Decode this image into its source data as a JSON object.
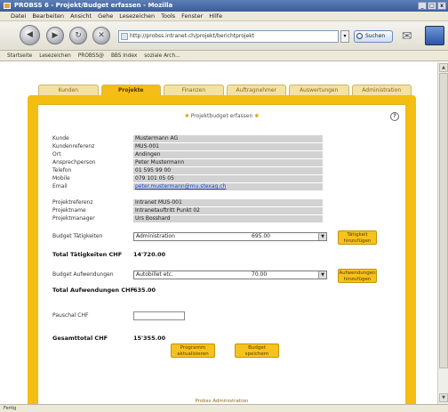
{
  "window": {
    "title": "PROBSS 6 - Projekt/Budget erfassen - Mozilla",
    "controls": [
      "_",
      "□",
      "x"
    ]
  },
  "menu": [
    "Datei",
    "Bearbeiten",
    "Ansicht",
    "Gehe",
    "Lesezeichen",
    "Tools",
    "Fenster",
    "Hilfe"
  ],
  "nav": {
    "url": "http://probss.intranet.ch/projekt/berichtprojekt",
    "search_label": "Suchen",
    "go_label": "▾"
  },
  "bookmarks": [
    "Startseite",
    "Lesezeichen",
    "PROBSS@",
    "BBS Index",
    "soziale Arch..."
  ],
  "tabs": [
    {
      "label": "Kunden",
      "active": false
    },
    {
      "label": "Projekte",
      "active": true
    },
    {
      "label": "Finanzen",
      "active": false
    },
    {
      "label": "Auftragnehmer",
      "active": false
    },
    {
      "label": "Auswertungen",
      "active": false
    },
    {
      "label": "Administration",
      "active": false
    }
  ],
  "panel": {
    "title": "Projektbudget erfassen",
    "help_icon": "?"
  },
  "client_info": [
    {
      "label": "Kunde",
      "value": "Mustermann AG"
    },
    {
      "label": "Kundenreferenz",
      "value": "MUS-001"
    },
    {
      "label": "Ort",
      "value": "Andingen"
    },
    {
      "label": "Ansprechperson",
      "value": "Peter Mustermann"
    },
    {
      "label": "Telefon",
      "value": "01 595 99 00"
    },
    {
      "label": "Mobile",
      "value": "079 101 05 05"
    },
    {
      "label": "Email",
      "value": "peter.mustermann@mu.stexag.ch",
      "link": true
    }
  ],
  "project_info": [
    {
      "label": "Projektreferenz",
      "value": "Intranet MUS-001"
    },
    {
      "label": "Projektname",
      "value": "Intranetauftritt Punkt 02"
    },
    {
      "label": "Projektmanager",
      "value": "Urs Bosshard"
    }
  ],
  "budget_activities": {
    "label": "Budget Tätigkeiten",
    "select_text": "Administration",
    "select_amount": "695.00",
    "button": "Tätigkeit hinzufügen"
  },
  "total_activities": {
    "label": "Total Tätigkeiten CHF",
    "value": "14'720.00"
  },
  "budget_expenses": {
    "label": "Budget Aufwendungen",
    "select_text": "Autobillet etc.",
    "select_amount": "70.00",
    "button": "Aufwendungen hinzufügen"
  },
  "total_expenses": {
    "label": "Total Aufwendungen CHF",
    "value": "635.00"
  },
  "pauschal": {
    "label": "Pauschal CHF",
    "value": ""
  },
  "grand_total": {
    "label": "Gesamttotal CHF",
    "value": "15'355.00"
  },
  "actions": {
    "update": "Programm aktualisieren",
    "save": "Budget speichern"
  },
  "footer_note": "Probss Administration",
  "status": "Fertig"
}
